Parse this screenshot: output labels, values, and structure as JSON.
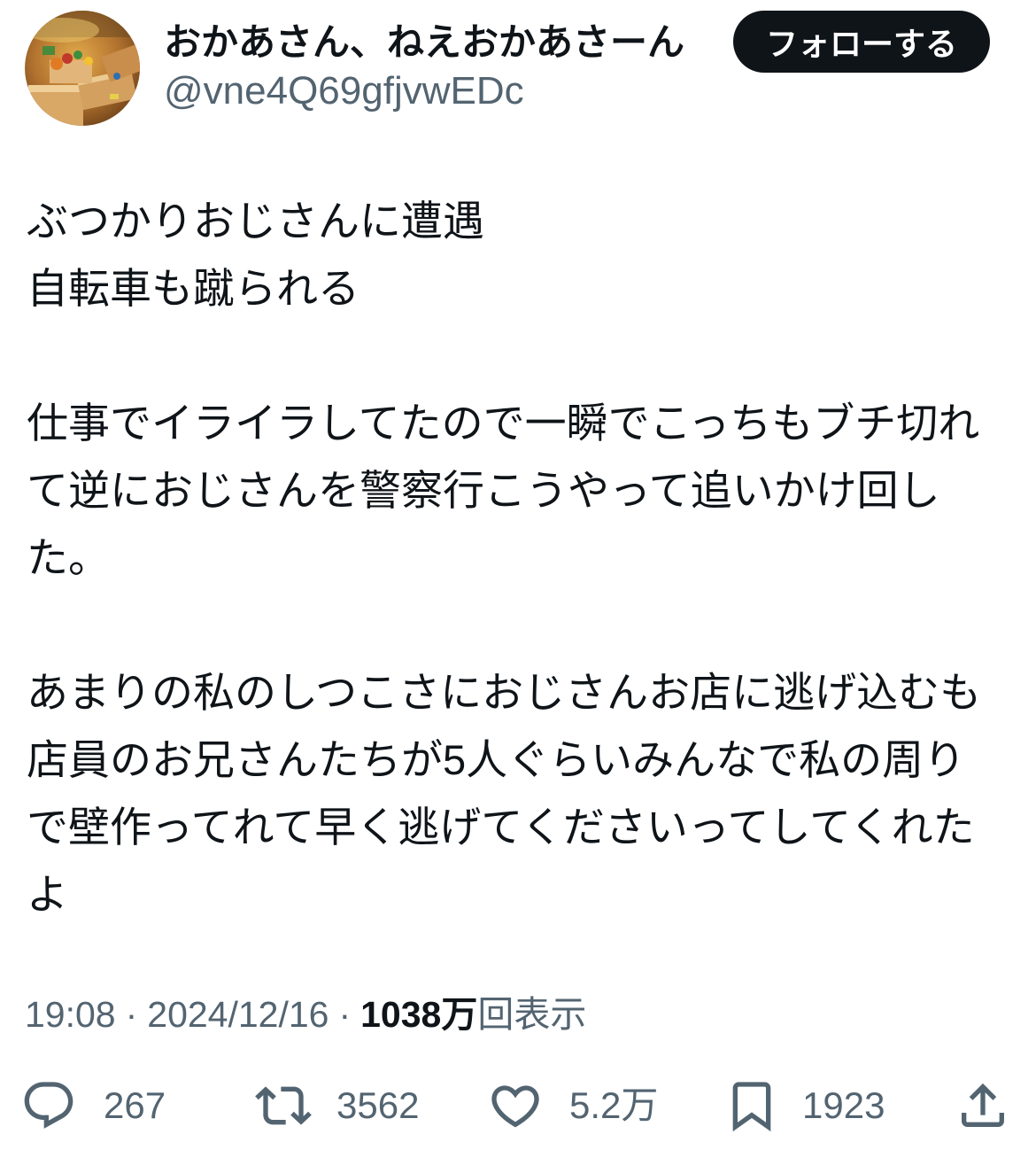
{
  "author": {
    "display_name": "おかあさん、ねえおかあさーん",
    "handle": "@vne4Q69gfjvwEDc",
    "follow_label": "フォローする"
  },
  "tweet": {
    "paragraphs": [
      [
        "ぶつかりおじさんに遭遇",
        "自転車も蹴られる"
      ],
      [
        "仕事でイライラしてたので一瞬でこっちもブチ切れ",
        "て逆におじさんを警察行こうやって追いかけ回し",
        "た。"
      ],
      [
        "あまりの私のしつこさにおじさんお店に逃げ込むも",
        "店員のお兄さんたちが5人ぐらいみんなで私の周り",
        "で壁作ってれて早く逃げてくださいってしてくれた",
        "よ"
      ]
    ]
  },
  "meta": {
    "time": "19:08",
    "separator": "·",
    "date": "2024/12/16",
    "views_count": "1038万",
    "views_label": "回表示"
  },
  "actions": {
    "reply": {
      "icon": "reply-icon",
      "count": "267"
    },
    "retweet": {
      "icon": "retweet-icon",
      "count": "3562"
    },
    "like": {
      "icon": "heart-icon",
      "count": "5.2万"
    },
    "bookmark": {
      "icon": "bookmark-icon",
      "count": "1923"
    },
    "share": {
      "icon": "share-icon"
    }
  },
  "colors": {
    "text": "#0f1419",
    "secondary": "#536471",
    "button_bg": "#0f1419",
    "button_text": "#ffffff",
    "background": "#ffffff"
  }
}
